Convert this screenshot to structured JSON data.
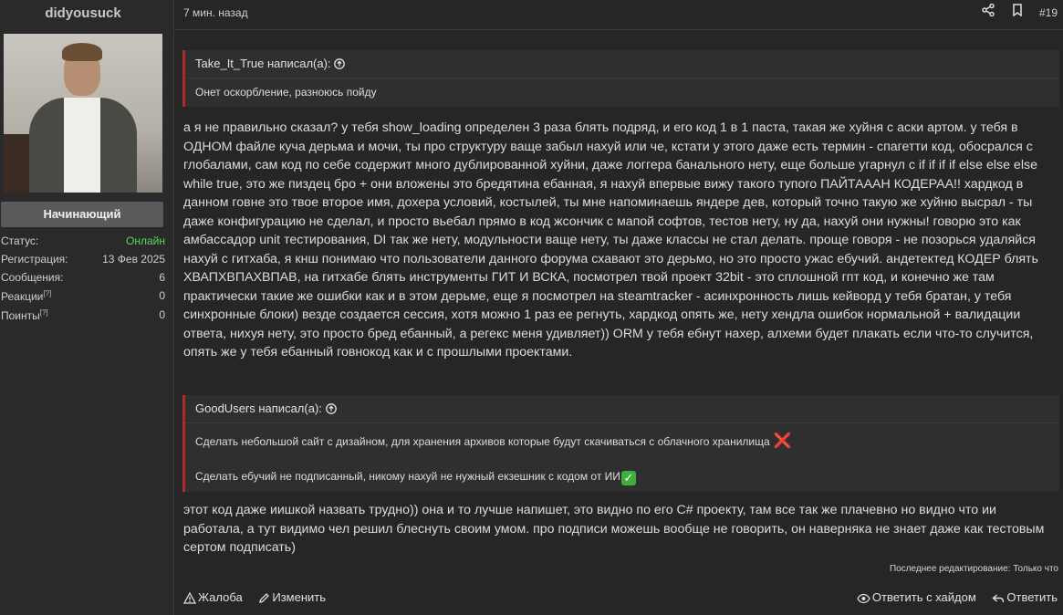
{
  "user": {
    "username": "didyousuck",
    "rank": "Начинающий",
    "stats": [
      {
        "label": "Статус:",
        "value": "Онлайн",
        "sup": ""
      },
      {
        "label": "Регистрация:",
        "value": "13 Фев 2025",
        "sup": ""
      },
      {
        "label": "Сообщения:",
        "value": "6",
        "sup": ""
      },
      {
        "label": "Реакции",
        "value": "0",
        "sup": "[?]"
      },
      {
        "label": "Поинты",
        "value": "0",
        "sup": "[?]"
      }
    ]
  },
  "post": {
    "time": "7 мин. назад",
    "number": "#19",
    "icons": [
      "share-icon",
      "bookmark-icon"
    ],
    "quote1": {
      "author": "Take_It_True написал(а):",
      "text": "Онет оскорбление, разноюсь пойду"
    },
    "body1": "а я не правильно сказал? у тебя show_loading определен 3 раза блять подряд, и его код 1 в 1 паста, такая же хуйня с аски артом. у тебя в ОДНОМ файле куча дерьма и мочи, ты про структуру ваще забыл нахуй или че, кстати у этого даже есть термин - спагетти код, обосрался с глобалами, сам код по себе содержит много дублированной хуйни, даже логгера банального нету, еще больше угарнул с if if if if else else else while true, это же пиздец бро + они вложены это бредятина ебанная, я нахуй впервые вижу такого тупого ПАЙТАААН КОДЕРАА!! хардкод в данном говне это твое второе имя, дохера условий, костылей, ты мне напоминаешь яндере дев, который точно такую же хуйню высрал - ты даже конфигурацию не сделал, и просто вьебал прямо в код жсончик с мапой софтов, тестов нету, ну да, нахуй они нужны! говорю это как амбассадор unit тестирования, DI так же нету, модульности ваще нету, ты даже классы не стал делать. проще говоря - не позорься удаляйся нахуй с гитхаба, я кнш понимаю что пользователи данного форума схавают это дерьмо, но это просто ужас ебучий. андетектед КОДЕР блять ХВАПХВПАХВПАВ, на гитхабе блять инструменты ГИТ И ВСКА, посмотрел твой проект 32bit - это сплошной гпт код, и конечно же там практически такие же ошибки как и в этом дерьме, еще я посмотрел на steamtracker - асинхронность лишь кейворд у тебя братан, у тебя синхронные блоки) везде создается сессия, хотя можно 1 раз ее регнуть, хардкод опять же, нету хендла ошибок нормальной + валидации ответа, нихуя нету, это просто бред ебанный, а регекс меня удивляет)) ORM у тебя ебнут нахер, алхеми будет плакать если что-то случится, опять же у тебя ебанный говнокод как и с прошлыми проектами.",
    "quote2": {
      "author": "GoodUsers написал(а):",
      "line1": "Сделать небольшой сайт с дизайном, для хранения архивов которые будут скачиваться с облачного хранилища",
      "line1_emoji": "❌",
      "line2": "Сделать ебучий не подписанный, никому нахуй не нужный екзешник с кодом от ИИ",
      "line2_emoji": "✅"
    },
    "body2": "этот код даже иишкой назвать трудно)) она и то лучше напишет, это видно по его C# проекту, там все так же плачевно но видно что ии работала, а тут видимо чел решил блеснуть своим умом. про подписи можешь вообще не говорить, он наверняка не знает даже как тестовым сертом подписать)",
    "edited": "Последнее редактирование: Только что",
    "actions": {
      "report": "Жалоба",
      "edit": "Изменить",
      "reply_hide": "Ответить с хайдом",
      "reply": "Ответить"
    }
  }
}
